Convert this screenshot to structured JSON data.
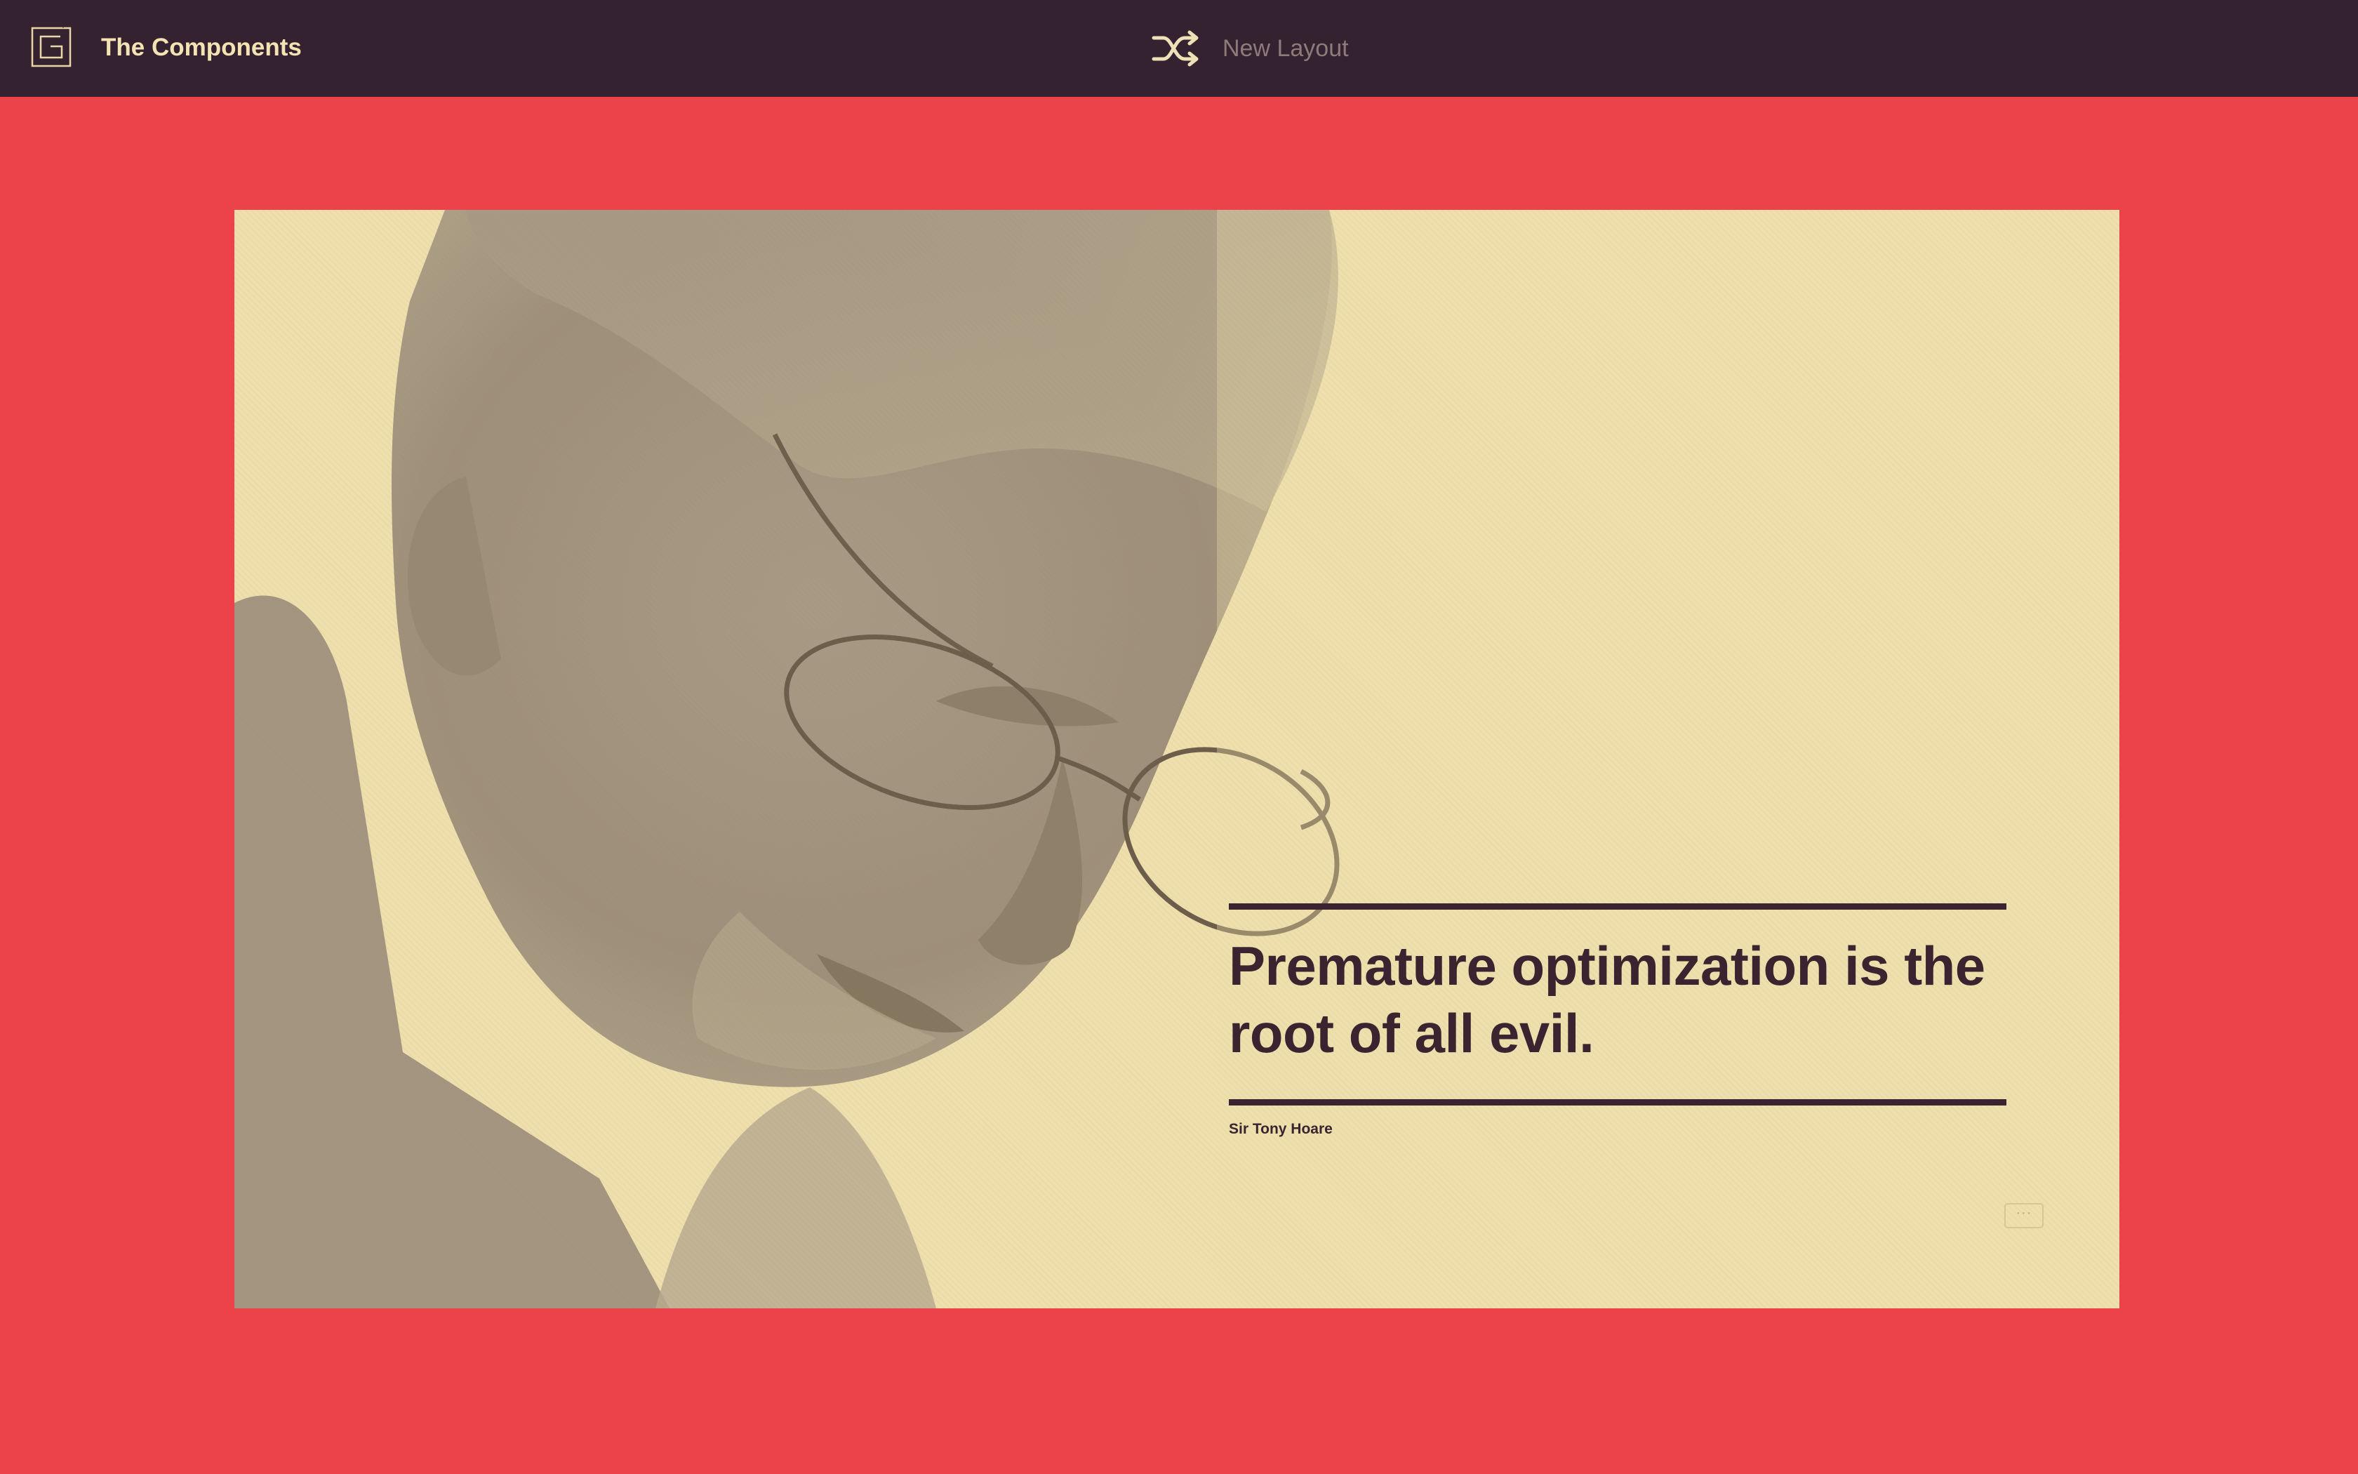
{
  "header": {
    "app_title": "The Components",
    "logo_icon": "g-square-logo-icon",
    "new_layout_label": "New Layout",
    "shuffle_icon": "shuffle-icon"
  },
  "card": {
    "quote": "Premature optimization is the root of all evil.",
    "attribution": "Sir Tony Hoare",
    "more_button_label": "···"
  },
  "colors": {
    "page_background": "#ec434a",
    "header_background": "#342230",
    "card_background": "#efdfad",
    "text_dark": "#3b2430",
    "header_text": "#f4e3b3"
  }
}
